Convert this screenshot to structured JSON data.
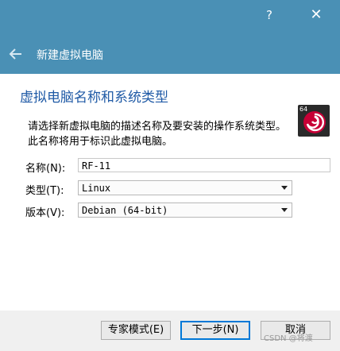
{
  "window": {
    "help_label": "?",
    "close_label": "✕",
    "wizard_title": "新建虚拟电脑"
  },
  "page": {
    "title": "虚拟电脑名称和系统类型",
    "description_line1": "请选择新虚拟电脑的描述名称及要安装的操作系统类型。",
    "description_line2": "此名称将用于标识此虚拟电脑。"
  },
  "form": {
    "name_label": "名称(N):",
    "name_value": "RF-11",
    "type_label": "类型(T):",
    "type_value": "Linux",
    "version_label": "版本(V):",
    "version_value": "Debian (64-bit)"
  },
  "os_icon": {
    "name": "debian-swirl-icon",
    "badge": "64",
    "accent": "#c70036"
  },
  "buttons": {
    "expert": "专家模式(E)",
    "next": "下一步(N)",
    "cancel": "取消"
  },
  "watermark": "CSDN @将渡",
  "colors": {
    "header": "#4a90b5",
    "title_text": "#1f5aa6"
  }
}
